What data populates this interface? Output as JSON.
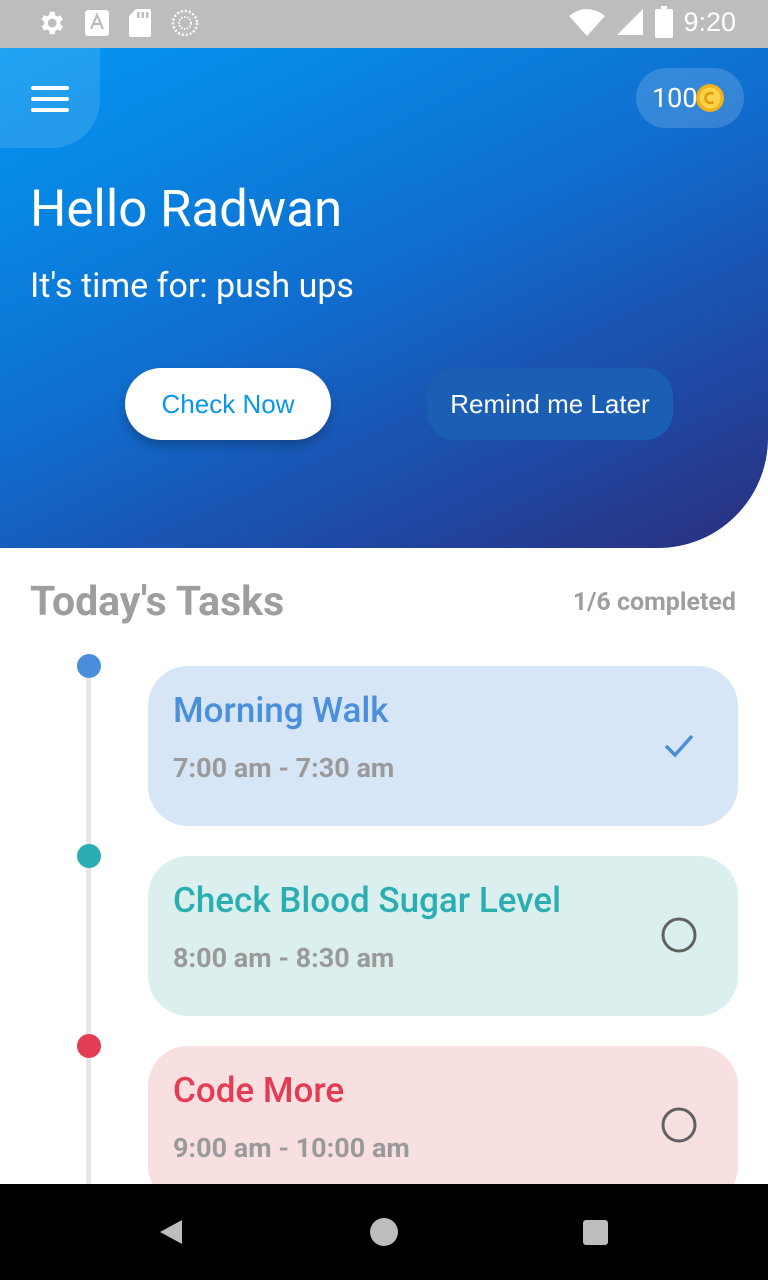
{
  "status_bar": {
    "time": "9:20",
    "icons": [
      "settings-icon",
      "keyboard-a-icon",
      "sd-card-icon",
      "sync-icon",
      "wifi-icon",
      "signal-icon",
      "battery-icon"
    ]
  },
  "header": {
    "menu_icon": "hamburger-menu-icon",
    "coins": "100",
    "coin_icon": "coin-icon",
    "greeting": "Hello Radwan",
    "reminder": "It's time for: push ups",
    "check_now_label": "Check Now",
    "remind_later_label": "Remind me Later",
    "colors": {
      "gradient_start": "#0398f2",
      "gradient_end": "#2b2f7d",
      "check_text": "#0a96ee",
      "later_bg": "#1a5fb4"
    }
  },
  "tasks": {
    "title": "Today's Tasks",
    "completed": "1/6 completed",
    "items": [
      {
        "title": "Morning Walk",
        "time": "7:00 am - 7:30 am",
        "done": true,
        "color": "#4a8fdc",
        "bg": "#d7e6f6"
      },
      {
        "title": "Check Blood Sugar Level",
        "time": "8:00 am - 8:30 am",
        "done": false,
        "color": "#2aaeb2",
        "bg": "#dbefef"
      },
      {
        "title": "Code More",
        "time": "9:00 am - 10:00 am",
        "done": false,
        "color": "#e33c54",
        "bg": "#f8e0e1"
      }
    ]
  },
  "nav_bar": {
    "icons": [
      "back-icon",
      "home-icon",
      "recents-icon"
    ]
  }
}
